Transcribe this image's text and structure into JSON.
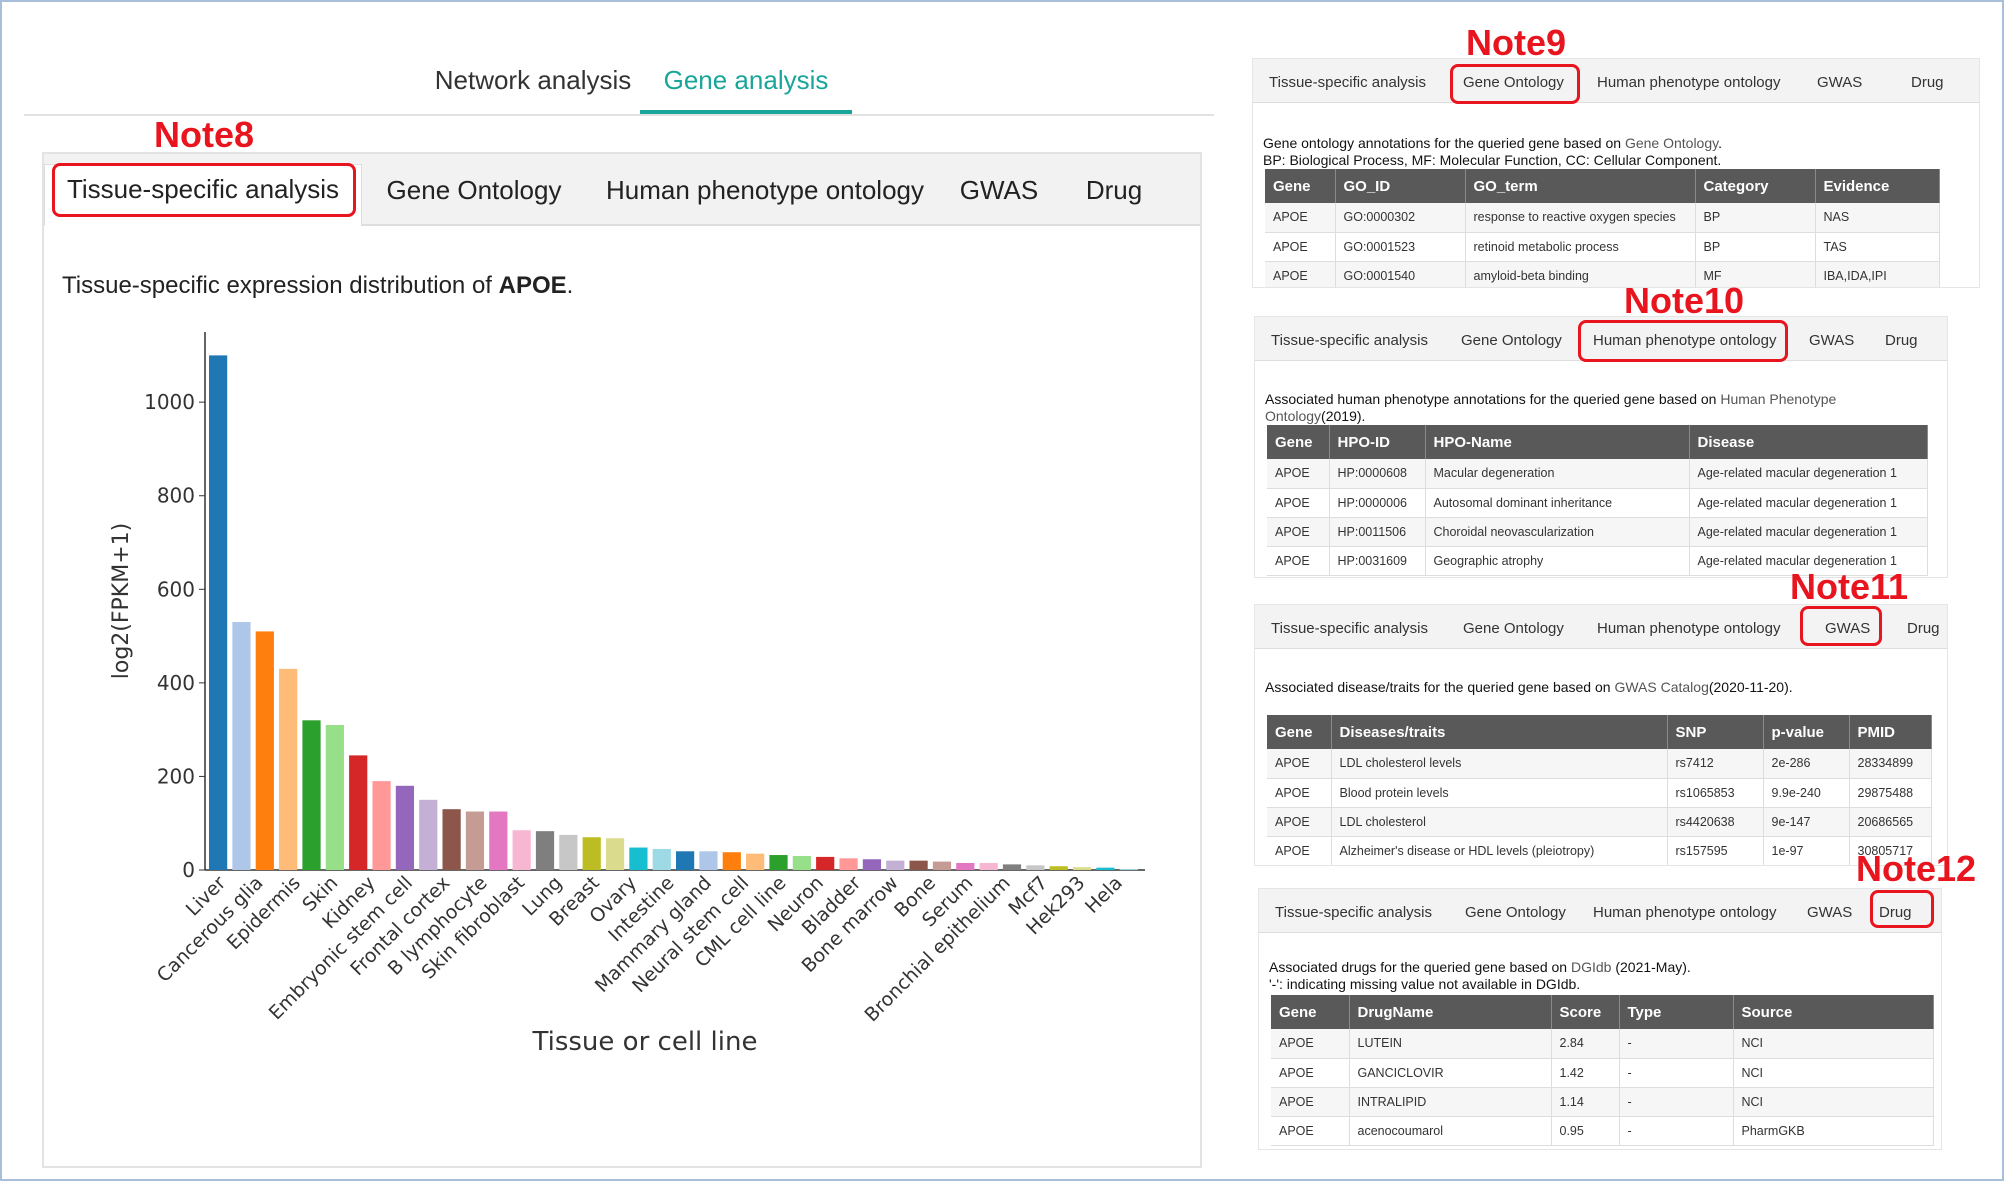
{
  "top_tabs": [
    "Network analysis",
    "Gene analysis"
  ],
  "sub_tabs": [
    "Tissue-specific analysis",
    "Gene Ontology",
    "Human phenotype ontology",
    "GWAS",
    "Drug"
  ],
  "notes": [
    "Note8",
    "Note9",
    "Note10",
    "Note11",
    "Note12"
  ],
  "heading": {
    "prefix": "Tissue-specific expression distribution of ",
    "gene": "APOE",
    "suffix": "."
  },
  "chart_data": {
    "type": "bar",
    "title": "",
    "xlabel": "Tissue or cell line",
    "ylabel": "log2(FPKM+1)",
    "ylim": [
      0,
      1150
    ],
    "yticks": [
      0,
      200,
      400,
      600,
      800,
      1000
    ],
    "grid": false,
    "categories": [
      "Liver",
      "Cancerous glia",
      "Epidermis",
      "Skin",
      "Kidney",
      "Embryonic stem cell",
      "Frontal cortex",
      "B lymphocyte",
      "Skin fibroblast",
      "Lung",
      "Breast",
      "Ovary",
      "Intestine",
      "Mammary gland",
      "Neural stem cell",
      "CML cell line",
      "Neuron",
      "Bladder",
      "Bone marrow",
      "Bone",
      "Serum",
      "Bronchial epithelium",
      "Mcf7",
      "Hek293",
      "Hela"
    ],
    "values": [
      1100,
      530,
      510,
      430,
      320,
      310,
      245,
      190,
      180,
      150,
      130,
      125,
      125,
      85,
      83,
      75,
      70,
      68,
      48,
      45,
      40,
      40,
      38,
      35,
      32,
      30,
      28,
      25,
      23,
      20,
      20,
      18,
      15,
      15,
      12,
      10,
      8,
      6,
      5,
      2
    ],
    "colors": [
      "#1f77b4",
      "#aec7e8",
      "#ff7f0e",
      "#ffbb78",
      "#2ca02c",
      "#98df8a",
      "#d62728",
      "#ff9896",
      "#9467bd",
      "#c5b0d5",
      "#8c564b",
      "#c49c94",
      "#e377c2",
      "#f7b6d2",
      "#7f7f7f",
      "#c7c7c7",
      "#bcbd22",
      "#dbdb8d",
      "#17becf",
      "#9edae5"
    ]
  },
  "go_panel": {
    "desc1_prefix": "Gene ontology annotations for the queried gene based on ",
    "desc1_link": "Gene Ontology",
    "desc1_suffix": ".",
    "desc2": "BP: Biological Process, MF: Molecular Function, CC: Cellular Component.",
    "headers": [
      "Gene",
      "GO_ID",
      "GO_term",
      "Category",
      "Evidence"
    ],
    "rows": [
      [
        "APOE",
        "GO:0000302",
        "response to reactive oxygen species",
        "BP",
        "NAS"
      ],
      [
        "APOE",
        "GO:0001523",
        "retinoid metabolic process",
        "BP",
        "TAS"
      ],
      [
        "APOE",
        "GO:0001540",
        "amyloid-beta binding",
        "MF",
        "IBA,IDA,IPI"
      ]
    ]
  },
  "hpo_panel": {
    "desc1_prefix": "Associated human phenotype annotations for the queried gene based on ",
    "desc1_link": "Human Phenotype",
    "desc2_link": "Ontology",
    "desc2_suffix": "(2019).",
    "headers": [
      "Gene",
      "HPO-ID",
      "HPO-Name",
      "Disease"
    ],
    "rows": [
      [
        "APOE",
        "HP:0000608",
        "Macular degeneration",
        "Age-related macular degeneration 1"
      ],
      [
        "APOE",
        "HP:0000006",
        "Autosomal dominant inheritance",
        "Age-related macular degeneration 1"
      ],
      [
        "APOE",
        "HP:0011506",
        "Choroidal neovascularization",
        "Age-related macular degeneration 1"
      ],
      [
        "APOE",
        "HP:0031609",
        "Geographic atrophy",
        "Age-related macular degeneration 1"
      ]
    ]
  },
  "gwas_panel": {
    "desc1_prefix": "Associated disease/traits for the queried gene based on ",
    "desc1_link": "GWAS Catalog",
    "desc1_suffix": "(2020-11-20).",
    "headers": [
      "Gene",
      "Diseases/traits",
      "SNP",
      "p-value",
      "PMID"
    ],
    "rows": [
      [
        "APOE",
        "LDL cholesterol levels",
        "rs7412",
        "2e-286",
        "28334899"
      ],
      [
        "APOE",
        "Blood protein levels",
        "rs1065853",
        "9.9e-240",
        "29875488"
      ],
      [
        "APOE",
        "LDL cholesterol",
        "rs4420638",
        "9e-147",
        "20686565"
      ],
      [
        "APOE",
        "Alzheimer's disease or HDL levels (pleiotropy)",
        "rs157595",
        "1e-97",
        "30805717"
      ]
    ]
  },
  "drug_panel": {
    "desc1_prefix": "Associated drugs for the queried gene based on ",
    "desc1_link": "DGIdb",
    "desc1_suffix": " (2021-May).",
    "desc2": "'-': indicating missing value not available in DGIdb.",
    "headers": [
      "Gene",
      "DrugName",
      "Score",
      "Type",
      "Source"
    ],
    "rows": [
      [
        "APOE",
        "LUTEIN",
        "2.84",
        "-",
        "NCI"
      ],
      [
        "APOE",
        "GANCICLOVIR",
        "1.42",
        "-",
        "NCI"
      ],
      [
        "APOE",
        "INTRALIPID",
        "1.14",
        "-",
        "NCI"
      ],
      [
        "APOE",
        "acenocoumarol",
        "0.95",
        "-",
        "PharmGKB"
      ]
    ]
  }
}
